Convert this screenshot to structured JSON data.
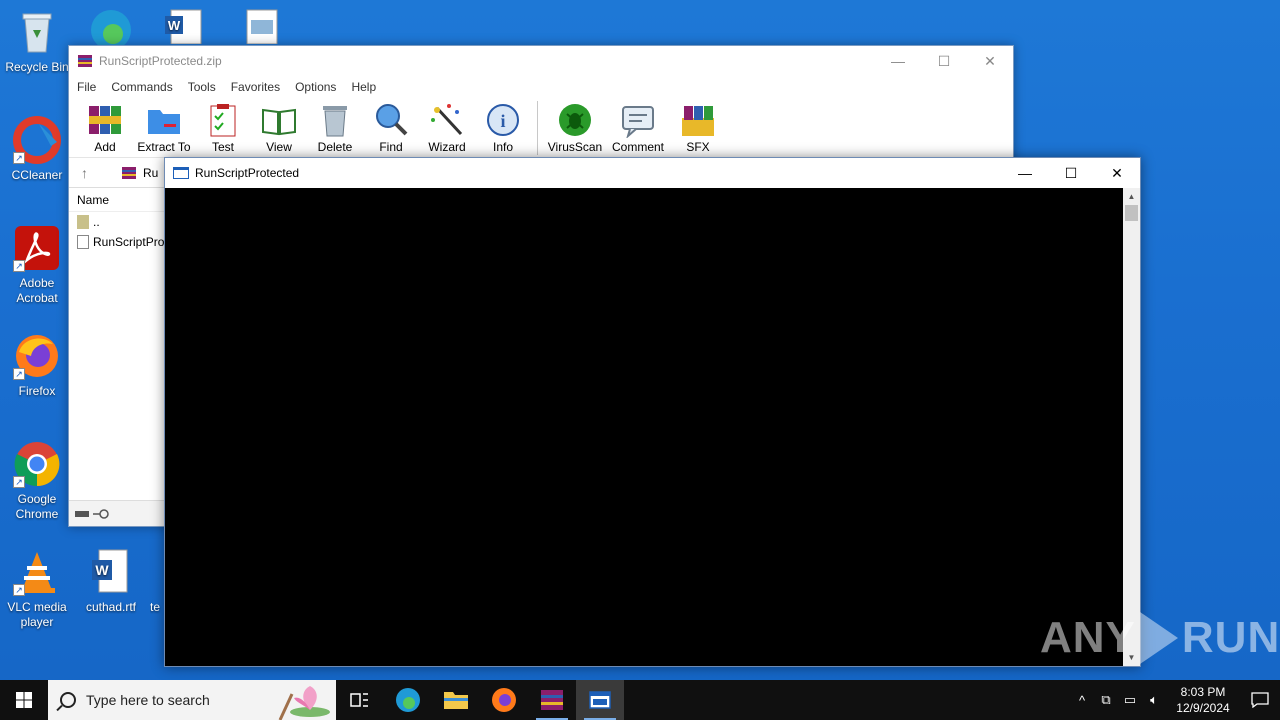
{
  "desktop": {
    "icons": [
      {
        "label": "Recycle Bin"
      },
      {
        "label": "CCleaner"
      },
      {
        "label": "Adobe Acrobat"
      },
      {
        "label": "Firefox"
      },
      {
        "label": "Google Chrome"
      },
      {
        "label": "VLC media player"
      },
      {
        "label": "cuthad.rtf"
      },
      {
        "label": "te"
      }
    ]
  },
  "winrar": {
    "title": "RunScriptProtected.zip",
    "menu": [
      "File",
      "Commands",
      "Tools",
      "Favorites",
      "Options",
      "Help"
    ],
    "toolbar": [
      "Add",
      "Extract To",
      "Test",
      "View",
      "Delete",
      "Find",
      "Wizard",
      "Info",
      "VirusScan",
      "Comment",
      "SFX"
    ],
    "address": "Ru",
    "column_name": "Name",
    "files": [
      "..",
      "RunScriptProt"
    ]
  },
  "console": {
    "title": "RunScriptProtected"
  },
  "watermark": {
    "left": "ANY",
    "right": "RUN"
  },
  "taskbar": {
    "search_placeholder": "Type here to search",
    "time": "8:03 PM",
    "date": "12/9/2024"
  },
  "colors": {
    "desktop_bg": "#1a6fd0",
    "taskbar_bg": "#101010",
    "console_bg": "#000000"
  }
}
